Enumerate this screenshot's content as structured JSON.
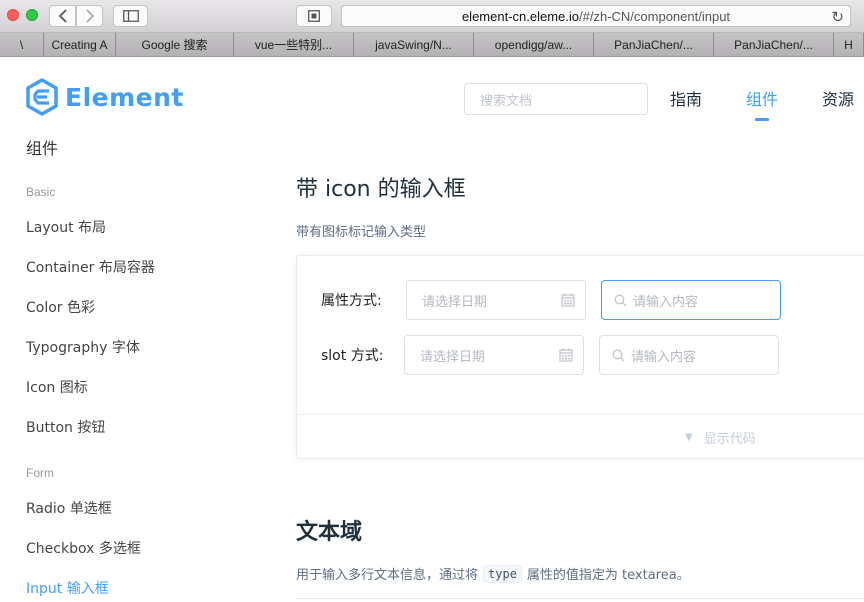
{
  "browser": {
    "url_host": "element-cn.eleme.io",
    "url_path": "/#/zh-CN/component/input",
    "bookmarks": [
      "\\",
      "Creating A",
      "Google 搜索",
      "vue一些特别...",
      "javaSwing/N...",
      "opendigg/aw...",
      "PanJiaChen/...",
      "PanJiaChen/...",
      "H"
    ]
  },
  "header": {
    "logo_text": "Element",
    "search_placeholder": "搜索文档",
    "nav": [
      "指南",
      "组件",
      "资源"
    ],
    "active_nav": "组件",
    "accent": "#409eff"
  },
  "sidebar": {
    "title": "组件",
    "groups": [
      {
        "label": "Basic",
        "items": [
          "Layout 布局",
          "Container 布局容器",
          "Color 色彩",
          "Typography 字体",
          "Icon 图标",
          "Button 按钮"
        ]
      },
      {
        "label": "Form",
        "items": [
          "Radio 单选框",
          "Checkbox 多选框",
          "Input 输入框"
        ]
      }
    ],
    "active_item": "Input 输入框"
  },
  "main": {
    "section1": {
      "title": "带 icon 的输入框",
      "description": "带有图标标记输入类型",
      "rows": [
        {
          "label": "属性方式:",
          "date_placeholder": "请选择日期",
          "search_placeholder": "请输入内容"
        },
        {
          "label": "slot 方式:",
          "date_placeholder": "请选择日期",
          "search_placeholder": "请输入内容"
        }
      ],
      "show_code": "显示代码"
    },
    "section2": {
      "title": "文本域",
      "desc_before": "用于输入多行文本信息，通过将",
      "desc_code": "type",
      "desc_after": "属性的值指定为 textarea。"
    }
  },
  "icons": {
    "back": "chevron-left-icon",
    "forward": "chevron-right-icon",
    "sidebar": "sidebar-icon",
    "reload": "reload-icon",
    "calendar": "calendar-icon",
    "search": "search-icon",
    "caret": "caret-down-icon"
  }
}
